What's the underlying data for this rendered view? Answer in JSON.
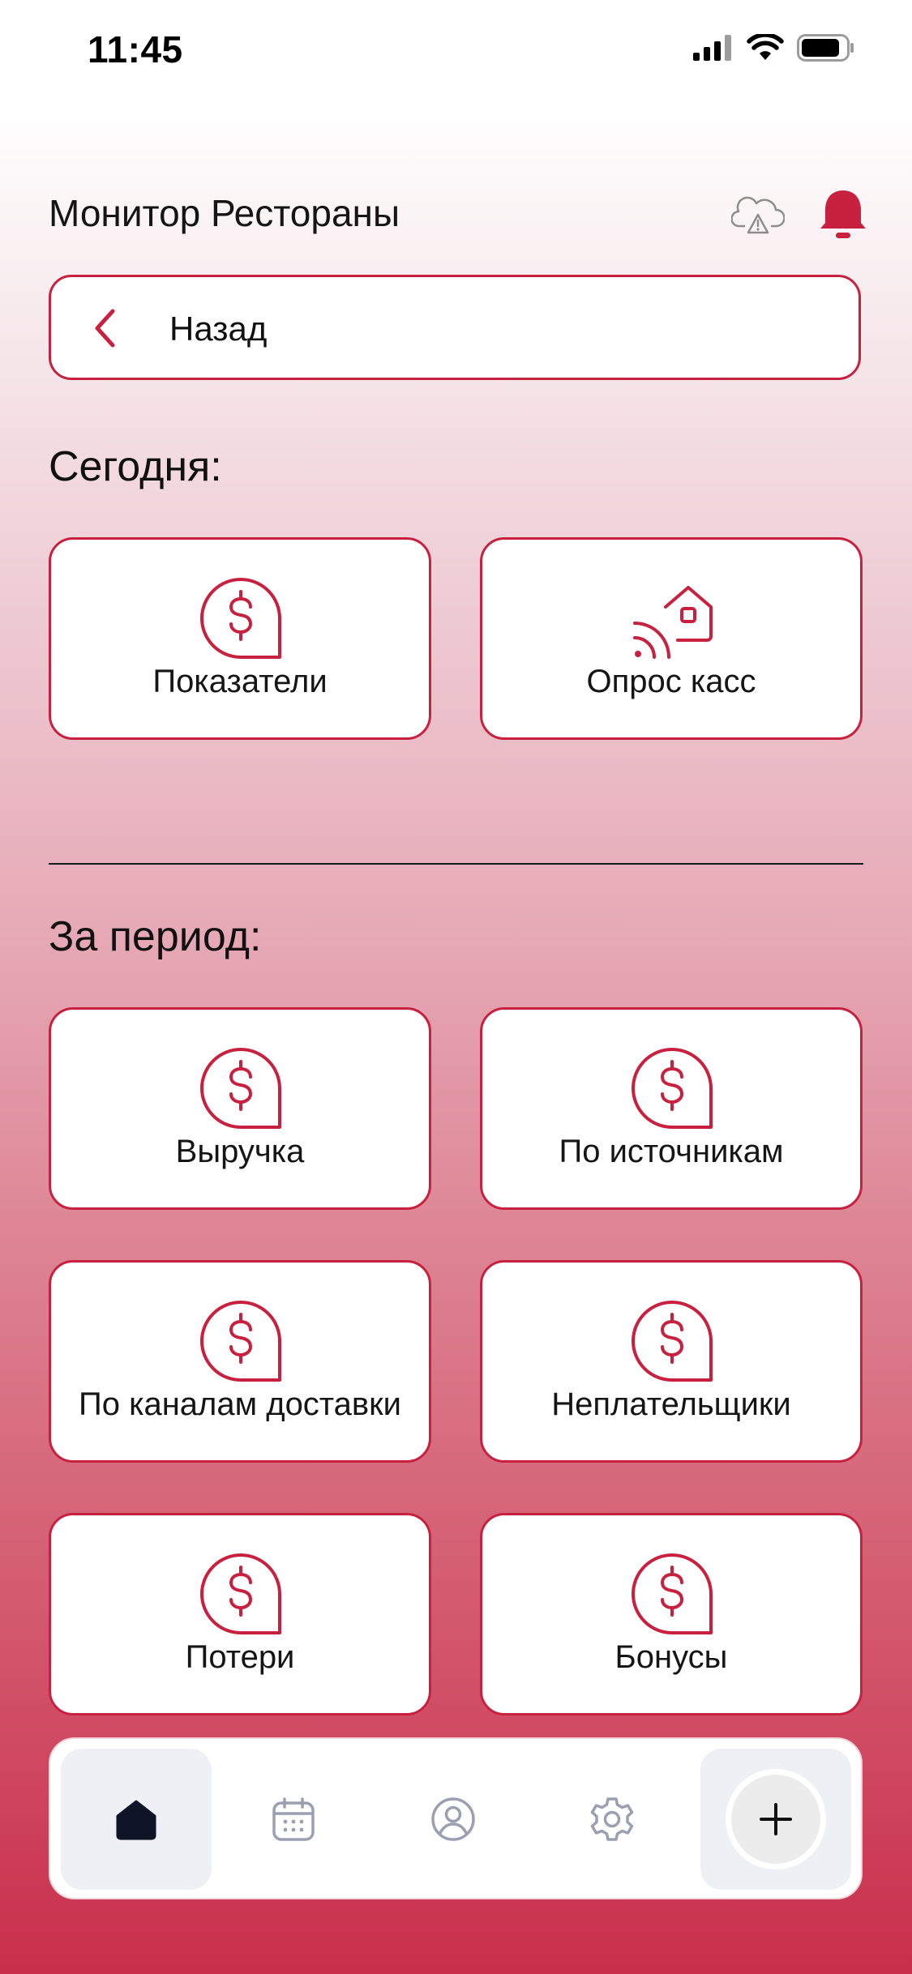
{
  "status_bar": {
    "time": "11:45"
  },
  "header": {
    "title": "Монитор Рестораны",
    "cloud_icon": "cloud-warning-icon",
    "bell_icon": "bell-icon"
  },
  "back_button": {
    "label": "Назад",
    "icon": "chevron-left-icon"
  },
  "today": {
    "title": "Сегодня:",
    "tiles": [
      {
        "label": "Показатели",
        "icon": "dollar-bubble-icon"
      },
      {
        "label": "Опрос касс",
        "icon": "home-signal-icon"
      }
    ]
  },
  "period": {
    "title": "За период:",
    "tiles": [
      {
        "label": "Выручка",
        "icon": "dollar-bubble-icon"
      },
      {
        "label": "По источникам",
        "icon": "dollar-bubble-icon"
      },
      {
        "label": "По каналам доставки",
        "icon": "dollar-bubble-icon"
      },
      {
        "label": "Неплательщики",
        "icon": "dollar-bubble-icon"
      },
      {
        "label": "Потери",
        "icon": "dollar-bubble-icon"
      },
      {
        "label": "Бонусы",
        "icon": "dollar-bubble-icon"
      }
    ]
  },
  "tabbar": {
    "items": [
      {
        "icon": "home-icon",
        "active": true
      },
      {
        "icon": "calendar-icon",
        "active": false
      },
      {
        "icon": "profile-icon",
        "active": false
      },
      {
        "icon": "settings-icon",
        "active": false
      },
      {
        "icon": "plus-icon",
        "active": false
      }
    ]
  },
  "colors": {
    "accent": "#c8213f",
    "tab_active_bg": "#eff0f5",
    "tab_icon": "#9aa0b1",
    "text": "#111111"
  }
}
